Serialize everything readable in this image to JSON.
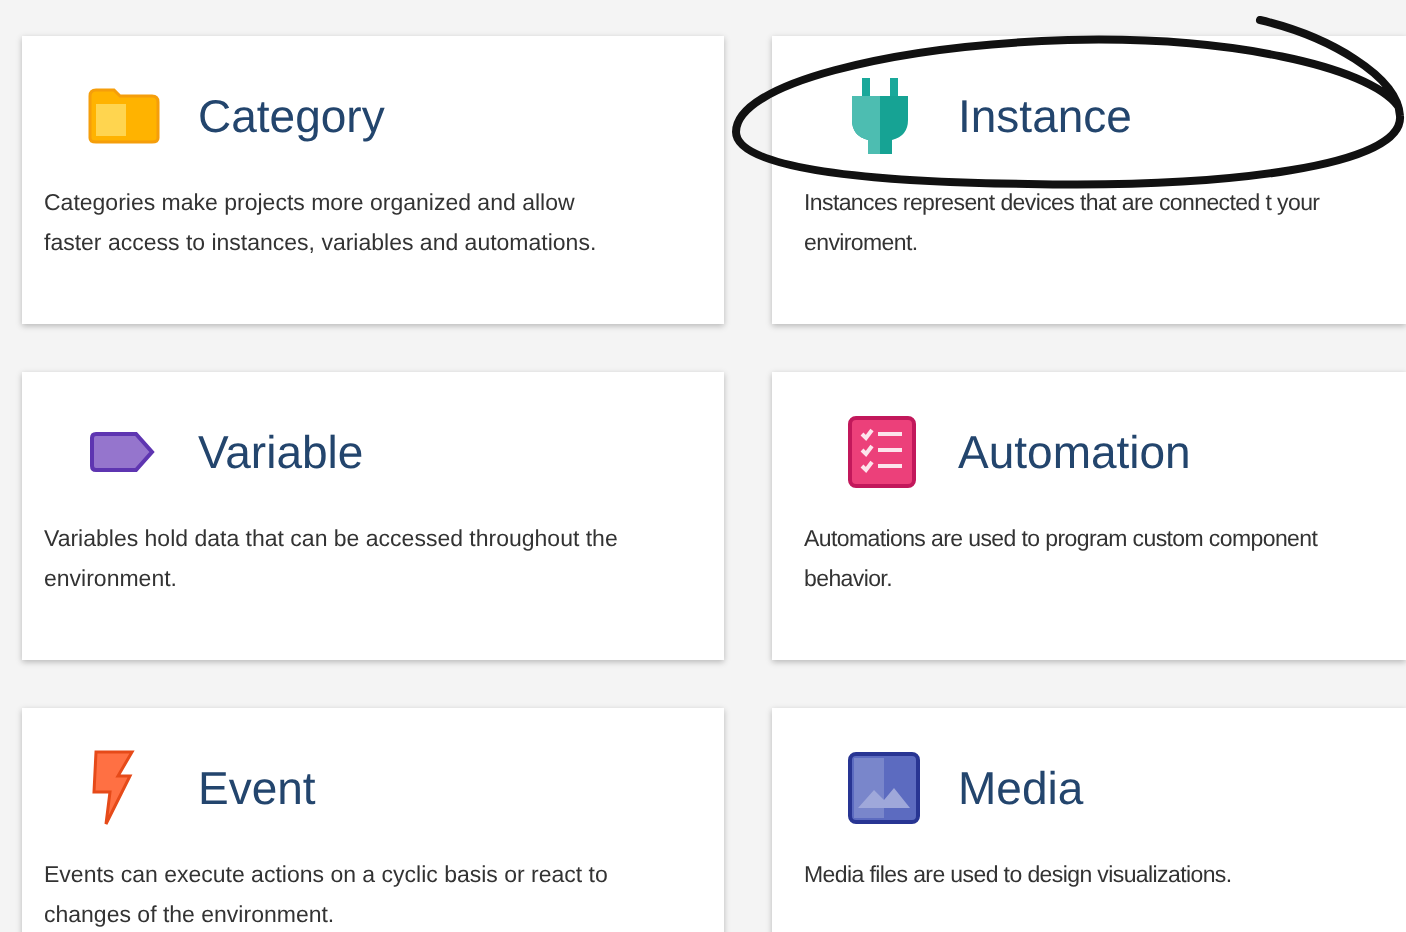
{
  "cards": [
    {
      "title": "Category",
      "description": "Categories make projects more organized and allow faster access to instances, variables and automations."
    },
    {
      "title": "Instance",
      "description": "Instances represent devices that are connected t your enviroment."
    },
    {
      "title": "Variable",
      "description": "Variables hold data that can be accessed throughout the environment."
    },
    {
      "title": "Automation",
      "description": "Automations are used to program custom component behavior."
    },
    {
      "title": "Event",
      "description": "Events can execute actions on a cyclic basis or react to changes of the environment."
    },
    {
      "title": "Media",
      "description": "Media files are used to design visualizations."
    }
  ]
}
